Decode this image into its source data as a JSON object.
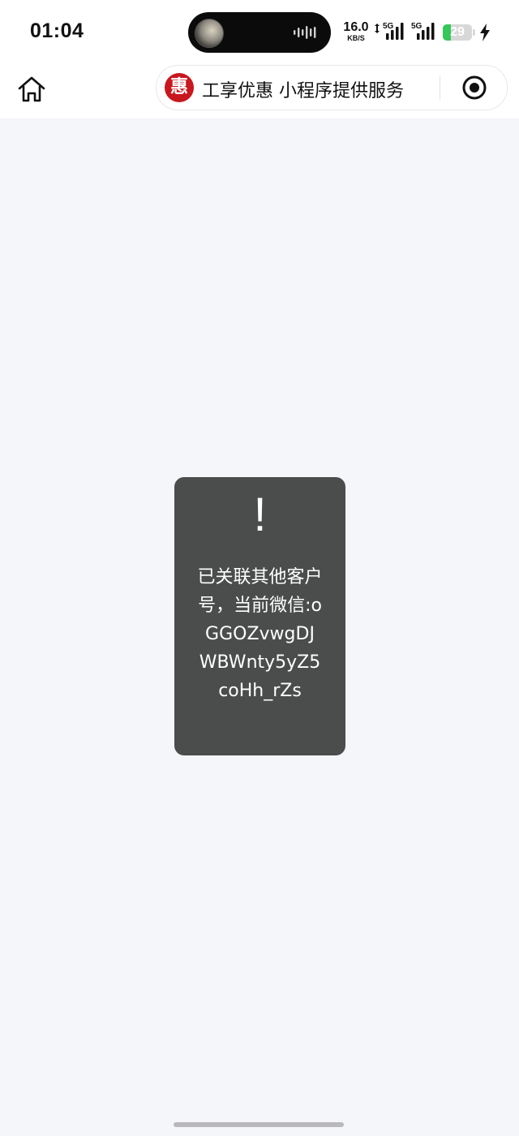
{
  "status_bar": {
    "time": "01:04",
    "net_speed_value": "16.0",
    "net_speed_unit": "KB/S",
    "sim1_label": "5G",
    "sim2_label": "5G",
    "battery_level": "29",
    "battery_percent": 29,
    "battery_color": "#34c759"
  },
  "nav_bar": {
    "logo_char": "惠",
    "logo_color": "#c8171e",
    "title": "工享优惠 小程序提供服务",
    "home_icon": "home-icon",
    "menu_icon": "target-icon"
  },
  "toast": {
    "icon": "!",
    "message": "已关联其他客户号，当前微信:oGGOZvwgDJWBWnty5yZ5coHh_rZs",
    "background": "#4b4c4c"
  },
  "colors": {
    "page_background": "#f5f6fa"
  }
}
